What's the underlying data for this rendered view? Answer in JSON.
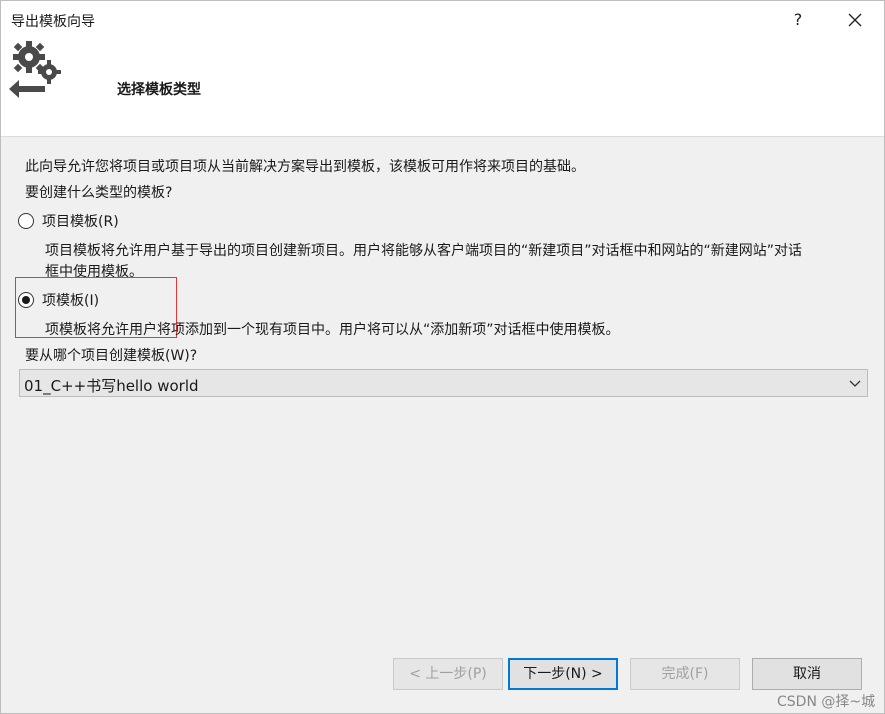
{
  "window": {
    "title": "导出模板向导",
    "help_label": "?"
  },
  "header": {
    "heading": "选择模板类型",
    "icon": "gear-export-icon"
  },
  "body": {
    "intro": "此向导允许您将项目或项目项从当前解决方案导出到模板，该模板可用作将来项目的基础。",
    "question": "要创建什么类型的模板?",
    "options": [
      {
        "label": "项目模板(R)",
        "selected": false,
        "desc_line1": "项目模板将允许用户基于导出的项目创建新项目。用户将能够从客户端项目的“新建项目”对话框中和网站的“新建网站”对话",
        "desc_line2": "框中使用模板。"
      },
      {
        "label": "项模板(I)",
        "selected": true,
        "desc_line1": "项模板将允许用户将项添加到一个现有项目中。用户将可以从“添加新项”对话框中使用模板。"
      }
    ],
    "project_label": "要从哪个项目创建模板(W)?",
    "project_value": "01_C++书写hello world"
  },
  "buttons": {
    "back": "< 上一步(P)",
    "next": "下一步(N) >",
    "finish": "完成(F)",
    "cancel": "取消"
  },
  "watermark": "CSDN @择~城",
  "colors": {
    "highlight_border": "#e03a3a",
    "primary_border": "#0078d7"
  }
}
